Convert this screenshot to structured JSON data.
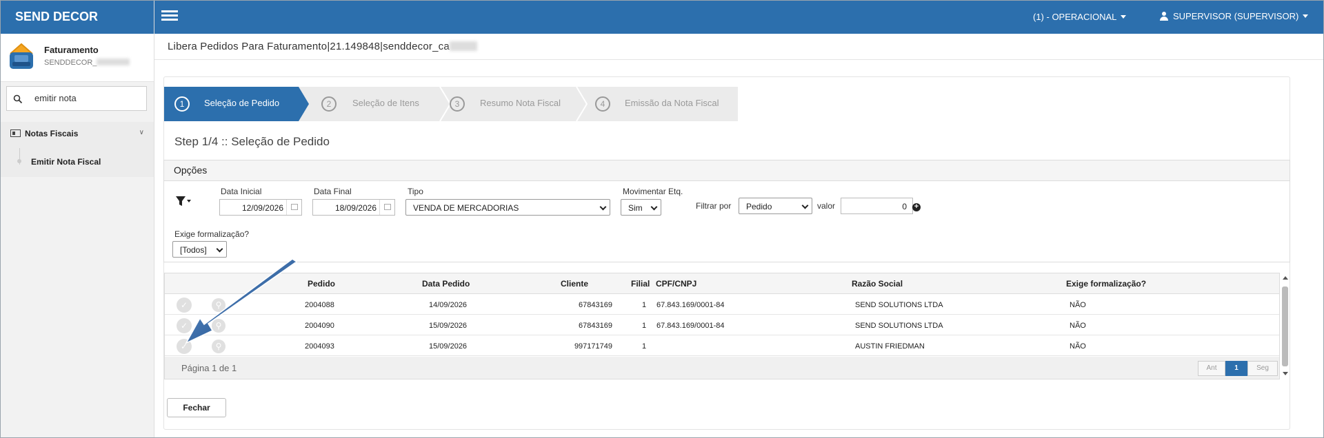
{
  "brand": "SEND DECOR",
  "colors": {
    "primary": "#2c6fad",
    "active_page": "#2c6fad"
  },
  "sidebar": {
    "module_title": "Faturamento",
    "module_subtitle": "SENDDECOR_",
    "search_value": "emitir nota",
    "group_label": "Notas Fiscais",
    "item_label": "Emitir Nota Fiscal"
  },
  "topbar": {
    "environment": "(1) - OPERACIONAL",
    "user": "SUPERVISOR (SUPERVISOR)"
  },
  "page": {
    "title": "Libera Pedidos Para Faturamento|21.149848|senddecor_ca"
  },
  "wizard": {
    "steps": [
      {
        "num": "1",
        "label": "Seleção de Pedido",
        "active": true
      },
      {
        "num": "2",
        "label": "Seleção de Itens",
        "active": false
      },
      {
        "num": "3",
        "label": "Resumo Nota Fiscal",
        "active": false
      },
      {
        "num": "4",
        "label": "Emissão da Nota Fiscal",
        "active": false
      }
    ]
  },
  "step_heading": "Step 1/4 :: Seleção de Pedido",
  "options": {
    "title": "Opções",
    "data_inicial_label": "Data Inicial",
    "data_inicial_value": "12/09/2026",
    "data_final_label": "Data Final",
    "data_final_value": "18/09/2026",
    "tipo_label": "Tipo",
    "tipo_value": "VENDA DE MERCADORIAS",
    "movimentar_label": "Movimentar Etq.",
    "movimentar_value": "Sim",
    "filtrar_label": "Filtrar por",
    "filtrar_value": "Pedido",
    "valor_label": "valor",
    "valor_value": "0",
    "exige_label": "Exige formalização?",
    "exige_value": "[Todos]"
  },
  "grid": {
    "headers": {
      "pedido": "Pedido",
      "data_pedido": "Data Pedido",
      "cliente": "Cliente",
      "filial": "Filial",
      "cpf": "CPF/CNPJ",
      "razao": "Razão Social",
      "exige": "Exige formalização?"
    },
    "rows": [
      {
        "pedido": "2004088",
        "data": "14/09/2026",
        "cliente": "67843169",
        "filial": "1",
        "cpf": "67.843.169/0001-84",
        "razao": "SEND SOLUTIONS LTDA",
        "exige": "NÃO"
      },
      {
        "pedido": "2004090",
        "data": "15/09/2026",
        "cliente": "67843169",
        "filial": "1",
        "cpf": "67.843.169/0001-84",
        "razao": "SEND SOLUTIONS LTDA",
        "exige": "NÃO"
      },
      {
        "pedido": "2004093",
        "data": "15/09/2026",
        "cliente": "997171749",
        "filial": "1",
        "cpf": "",
        "razao": "AUSTIN FRIEDMAN",
        "exige": "NÃO"
      }
    ],
    "page_info": "Página 1 de 1",
    "pager": {
      "prev": "Ant",
      "current": "1",
      "next": "Seg"
    }
  },
  "close_label": "Fechar",
  "icons": {
    "check": "check-icon",
    "magnifier": "magnifier-icon"
  }
}
